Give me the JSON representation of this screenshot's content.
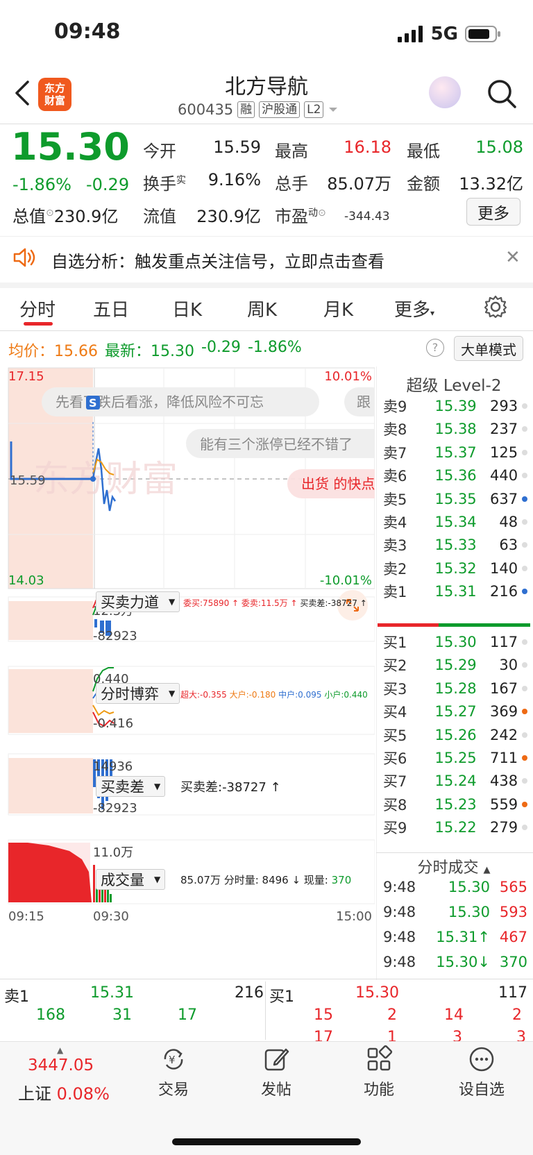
{
  "status_bar": {
    "time": "09:48",
    "network": "5G"
  },
  "header": {
    "logo_line1": "东方",
    "logo_line2": "财富",
    "stock_name": "北方导航",
    "stock_code": "600435",
    "tags": [
      "融",
      "沪股通",
      "L2"
    ]
  },
  "quote": {
    "last_price": "15.30",
    "change_pct": "-1.86%",
    "change_amt": "-0.29",
    "open_label": "今开",
    "open": "15.59",
    "high_label": "最高",
    "high": "16.18",
    "low_label": "最低",
    "low": "15.08",
    "turnover_label": "换手",
    "turnover_sup": "实",
    "turnover": "9.16%",
    "volume_label": "总手",
    "volume": "85.07万",
    "amount_label": "金额",
    "amount": "13.32亿",
    "total_mv_label": "总值",
    "total_mv": "230.9亿",
    "float_mv_label": "流值",
    "float_mv": "230.9亿",
    "pe_label": "市盈",
    "pe_sup": "动",
    "pe": "-344.43",
    "more_label": "更多"
  },
  "banner": {
    "text": "自选分析：触发重点关注信号，立即点击查看"
  },
  "tabs": [
    {
      "label": "分时"
    },
    {
      "label": "五日"
    },
    {
      "label": "日K"
    },
    {
      "label": "周K"
    },
    {
      "label": "月K"
    },
    {
      "label": "更多"
    }
  ],
  "summary": {
    "avg_label": "均价：",
    "avg": "15.66",
    "latest_label": "最新：",
    "latest": "15.30",
    "chg_amt": "-0.29",
    "chg_pct": "-1.86%",
    "help": "?",
    "big_order_mode": "大单模式"
  },
  "chart": {
    "price_high": "17.15",
    "price_mid": "15.59",
    "price_low": "14.03",
    "pct_high": "10.01%",
    "pct_low": "-10.01%",
    "signal_marker": "S",
    "watermark": "东方财富",
    "bubbles": [
      "先看下跌后看涨，降低风险不可忘",
      "能有三个涨停已经不错了",
      "出货 的快点",
      "跟"
    ],
    "times": [
      "09:15",
      "09:30",
      "15:00"
    ]
  },
  "indicators": {
    "force": {
      "label": "买卖力道",
      "info_buy": "委买:75890 ↑",
      "info_sell": "委卖:11.5万 ↑",
      "info_diff": "买卖差:-38727 ↑",
      "top": "12.3万",
      "bottom": "-82923"
    },
    "game": {
      "label": "分时博弈",
      "super": "超大:-0.355",
      "large": "大户:-0.180",
      "mid": "中户:0.095",
      "small": "小户:0.440",
      "top": "0.440",
      "bottom": "-0.416"
    },
    "diff": {
      "label": "买卖差",
      "info": "买卖差:-38727 ↑",
      "top": "14936",
      "bottom": "-82923"
    },
    "volume": {
      "label": "成交量",
      "info": "85.07万 分时量: 8496 ↓ 现量: ",
      "now": "370",
      "top": "11.0万"
    }
  },
  "order_book": {
    "title": "超级 Level-2",
    "asks": [
      {
        "label": "卖9",
        "price": "15.39",
        "vol": "293",
        "dot": "gray"
      },
      {
        "label": "卖8",
        "price": "15.38",
        "vol": "237",
        "dot": "gray"
      },
      {
        "label": "卖7",
        "price": "15.37",
        "vol": "125",
        "dot": "gray"
      },
      {
        "label": "卖6",
        "price": "15.36",
        "vol": "440",
        "dot": "gray"
      },
      {
        "label": "卖5",
        "price": "15.35",
        "vol": "637",
        "dot": "blue"
      },
      {
        "label": "卖4",
        "price": "15.34",
        "vol": "48",
        "dot": "gray"
      },
      {
        "label": "卖3",
        "price": "15.33",
        "vol": "63",
        "dot": "gray"
      },
      {
        "label": "卖2",
        "price": "15.32",
        "vol": "140",
        "dot": "gray"
      },
      {
        "label": "卖1",
        "price": "15.31",
        "vol": "216",
        "dot": "blue"
      }
    ],
    "bids": [
      {
        "label": "买1",
        "price": "15.30",
        "vol": "117",
        "dot": "gray"
      },
      {
        "label": "买2",
        "price": "15.29",
        "vol": "30",
        "dot": "gray"
      },
      {
        "label": "买3",
        "price": "15.28",
        "vol": "167",
        "dot": "gray"
      },
      {
        "label": "买4",
        "price": "15.27",
        "vol": "369",
        "dot": "orange"
      },
      {
        "label": "买5",
        "price": "15.26",
        "vol": "242",
        "dot": "gray"
      },
      {
        "label": "买6",
        "price": "15.25",
        "vol": "711",
        "dot": "orange"
      },
      {
        "label": "买7",
        "price": "15.24",
        "vol": "438",
        "dot": "gray"
      },
      {
        "label": "买8",
        "price": "15.23",
        "vol": "559",
        "dot": "orange"
      },
      {
        "label": "买9",
        "price": "15.22",
        "vol": "279",
        "dot": "gray"
      }
    ]
  },
  "ticks": {
    "title": "分时成交",
    "rows": [
      {
        "time": "9:48",
        "price": "15.30",
        "vol": "565",
        "color": "red"
      },
      {
        "time": "9:48",
        "price": "15.30",
        "vol": "593",
        "color": "red"
      },
      {
        "time": "9:48",
        "price": "15.31↑",
        "vol": "467",
        "color": "red"
      },
      {
        "time": "9:48",
        "price": "15.30↓",
        "vol": "370",
        "color": "green"
      }
    ]
  },
  "bottom_strip": {
    "sell_label": "卖1",
    "sell_price": "15.31",
    "sell_vol": "216",
    "buy_label": "买1",
    "buy_price": "15.30",
    "buy_vol": "117",
    "sell_queue": [
      "168",
      "31",
      "17"
    ],
    "buy_queue": [
      "15",
      "2",
      "14",
      "2"
    ],
    "buy_queue2": [
      "17",
      "1",
      "3",
      "3"
    ]
  },
  "tabbar": {
    "index_value": "3447.05",
    "index_name": "上证",
    "index_pct": "0.08%",
    "items": [
      {
        "label": "交易",
        "icon": "yuan-exchange-icon"
      },
      {
        "label": "发帖",
        "icon": "edit-icon"
      },
      {
        "label": "功能",
        "icon": "grid-icon"
      },
      {
        "label": "设自选",
        "icon": "more-circle-icon"
      }
    ]
  },
  "colors": {
    "up": "#e8262a",
    "down": "#0e9b2c",
    "avg": "#ee9a14",
    "line": "#2f6fd0",
    "pre_session": "#fbe3da"
  }
}
